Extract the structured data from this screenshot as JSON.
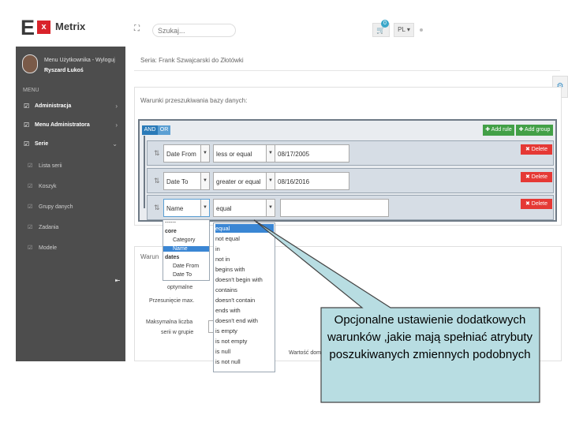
{
  "app": {
    "logo_letter": "E",
    "logo_x": "x",
    "logo_name": "Metrix"
  },
  "topbar": {
    "search_placeholder": "Szukaj...",
    "cart_count": "0",
    "language": "PL ▾"
  },
  "sidebar": {
    "user_line1": "Menu Użytkownika - Wyloguj",
    "user_name": "Ryszard Łukoś",
    "menu_label": "MENU",
    "items": [
      {
        "label": "Administracja",
        "arrow": "›"
      },
      {
        "label": "Menu Administratora",
        "arrow": "›"
      },
      {
        "label": "Serie",
        "arrow": "⌄"
      }
    ],
    "subitems": [
      "Lista serii",
      "Koszyk",
      "Grupy danych",
      "Zadania",
      "Modele"
    ]
  },
  "breadcrumb": "Seria:  Frank Szwajcarski do Złotówki",
  "panel_title": "Warunki przeszukiwania bazy danych:",
  "query_builder": {
    "and_label": "AND",
    "or_label": "OR",
    "add_rule": "✚ Add rule",
    "add_group": "✚ Add group",
    "delete_label": "✖ Delete",
    "rules": [
      {
        "field": "Date From",
        "operator": "less or equal",
        "value": "08/17/2005"
      },
      {
        "field": "Date To",
        "operator": "greater or equal",
        "value": "08/16/2016"
      },
      {
        "field": "Name",
        "operator": "equal",
        "value": ""
      }
    ]
  },
  "field_dropdown": {
    "separator": "------",
    "groups": [
      {
        "name": "core",
        "options": [
          "Category",
          "Name"
        ]
      },
      {
        "name": "dates",
        "options": [
          "Date From",
          "Date To"
        ]
      }
    ],
    "selected": "Name"
  },
  "operator_dropdown": {
    "options": [
      "equal",
      "not equal",
      "in",
      "not in",
      "begins with",
      "doesn't begin with",
      "contains",
      "doesn't contain",
      "ends with",
      "doesn't end with",
      "is empty",
      "is not empty",
      "is null",
      "is not null"
    ],
    "selected": "equal"
  },
  "panel2": {
    "title": "Warun",
    "label_optimal": "optymalne",
    "label_max": "Przesunięcie max.",
    "label_group1": "Maksymalna liczba",
    "label_group2": "serii w grupie",
    "label_value": "Wartość dom"
  },
  "callout": {
    "text": "Opcjonalne ustawienie dodatkowych warunków ,jakie mają spełniać atrybuty poszukiwanych zmiennych podobnych",
    "fill": "#b8dde2",
    "border": "#444444"
  }
}
